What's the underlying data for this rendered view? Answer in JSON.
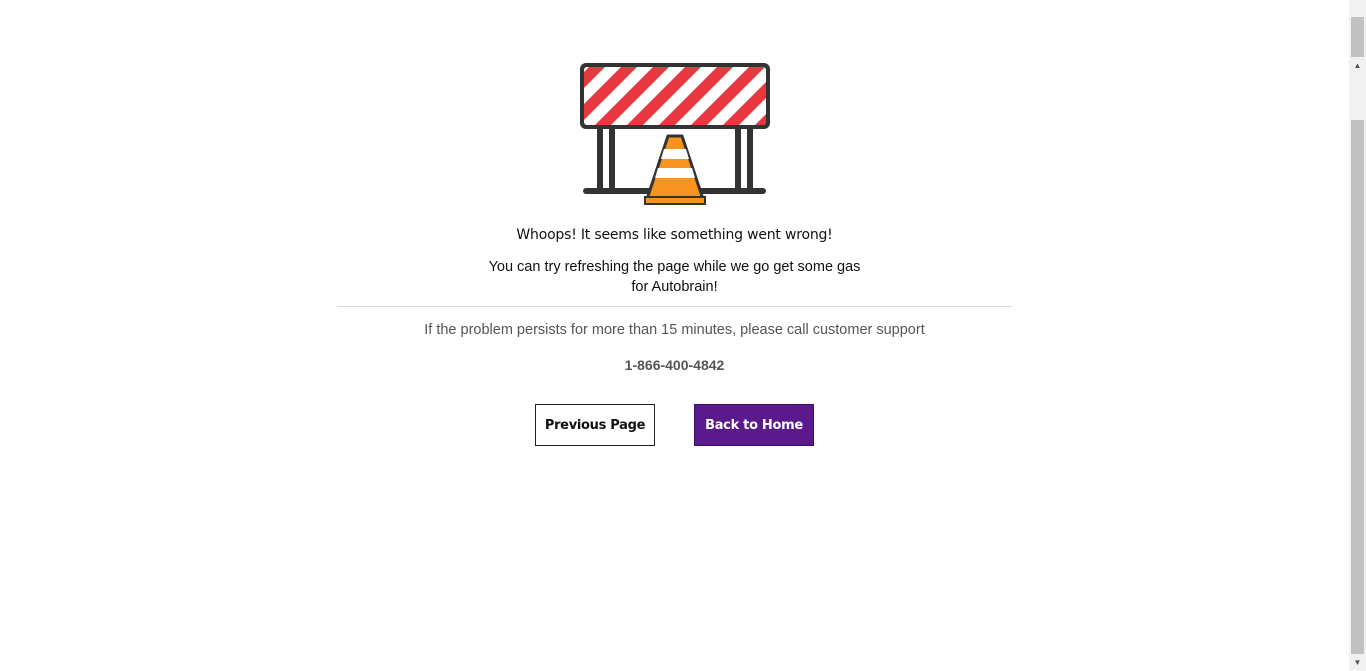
{
  "error": {
    "title": "Whoops! It seems like something went wrong!",
    "subtitle": "You can try refreshing the page while we go get some gas for Autobrain!",
    "support_text": "If the problem persists for more than 15 minutes, please call customer support",
    "phone": "1-866-400-4842"
  },
  "buttons": {
    "previous_label": "Previous Page",
    "home_label": "Back to Home"
  },
  "illustration": {
    "icon": "road-barrier-with-traffic-cone",
    "barrier_stripe_color": "#e8383d",
    "frame_color": "#333333",
    "cone_color": "#f7931e"
  },
  "colors": {
    "primary_button": "#5a1a8c"
  }
}
